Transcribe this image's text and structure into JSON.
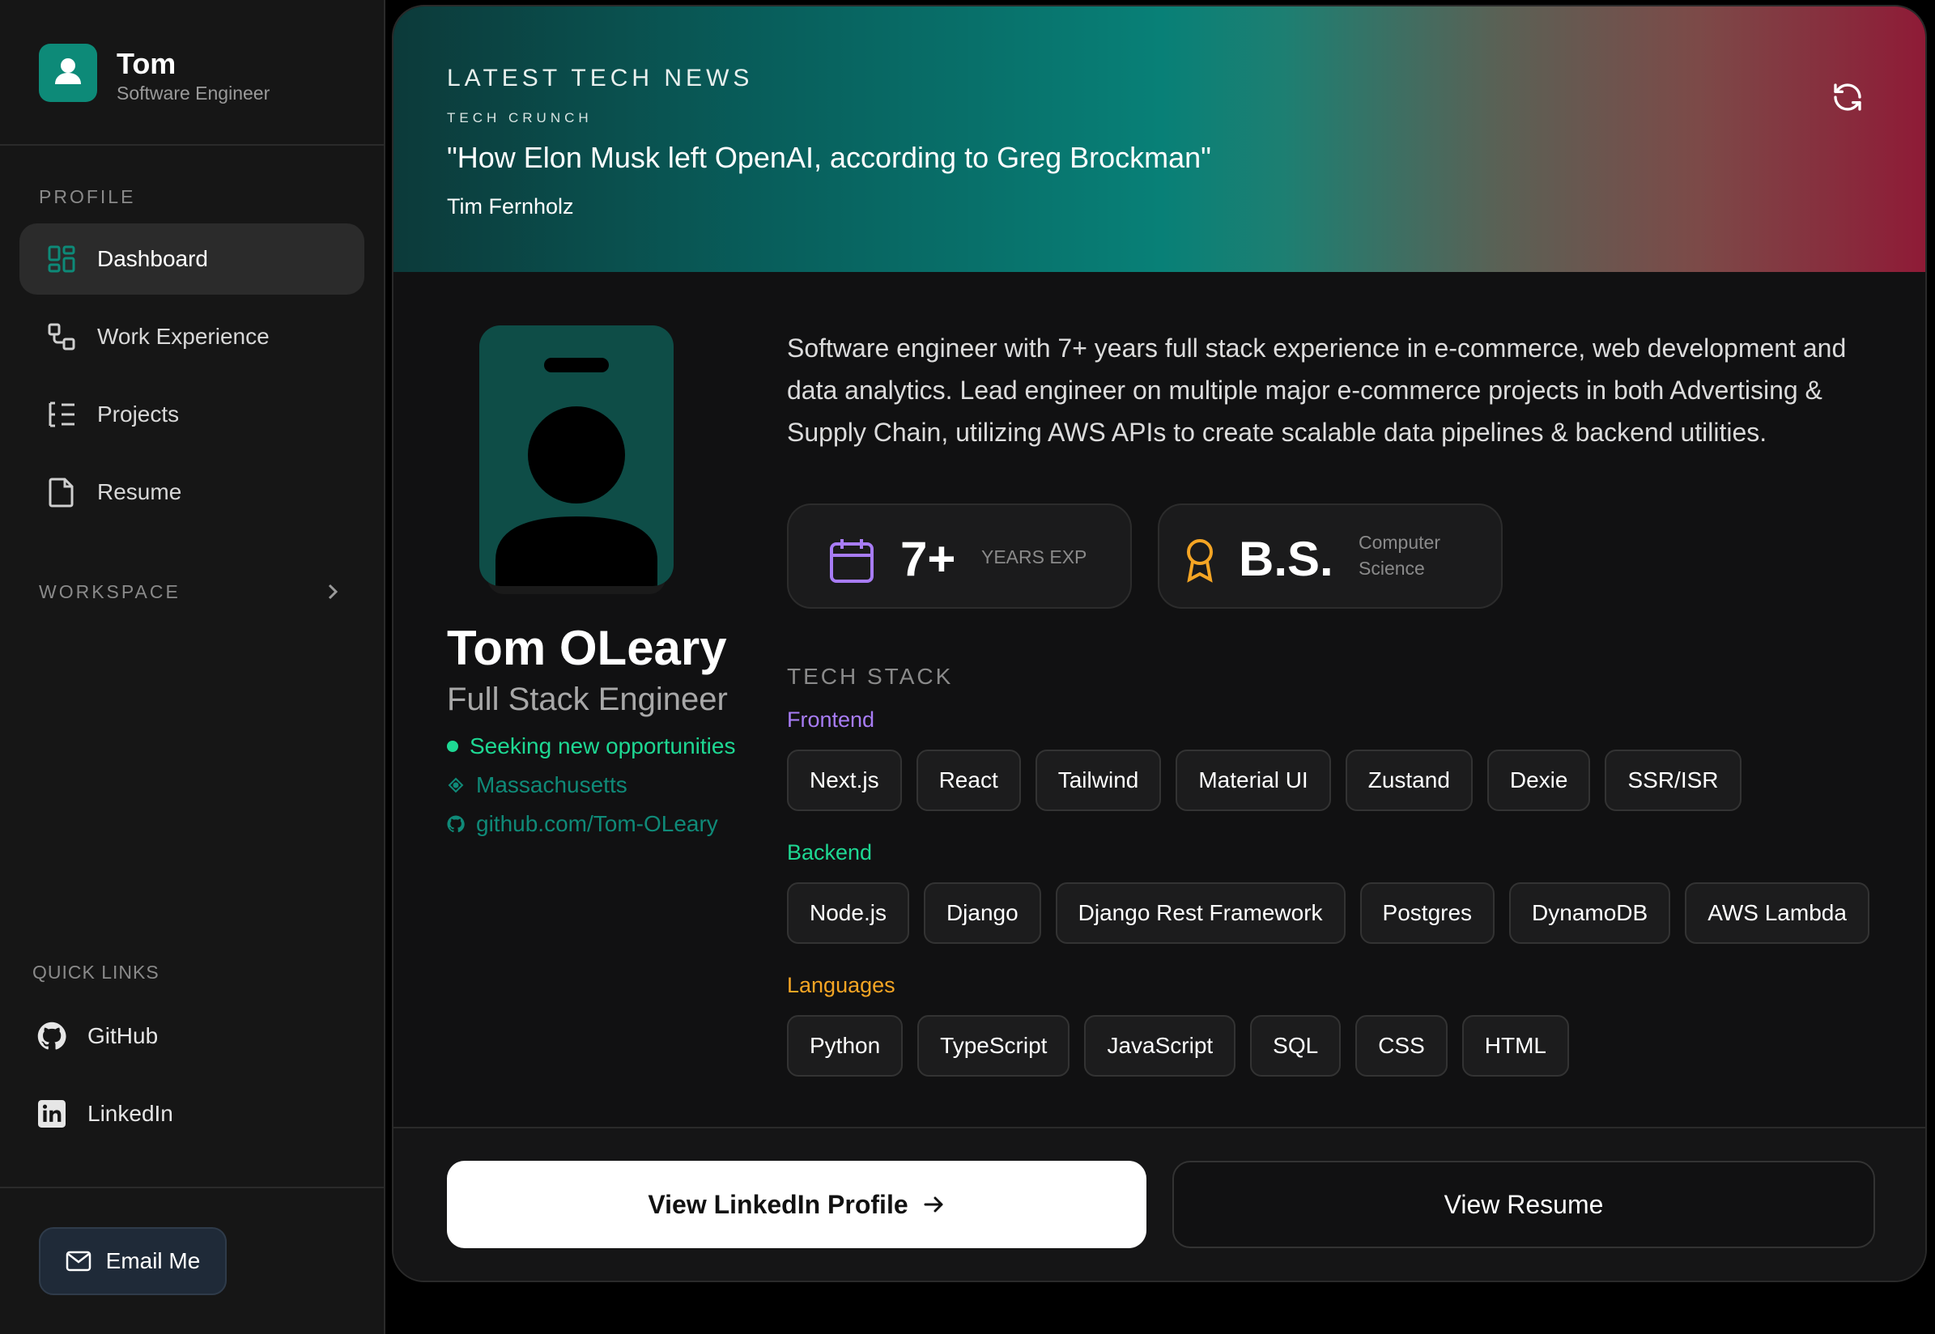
{
  "sidebar": {
    "user": {
      "name": "Tom",
      "role": "Software Engineer",
      "icon": "user-icon"
    },
    "profile_label": "PROFILE",
    "nav": [
      {
        "label": "Dashboard",
        "icon": "dashboard-grid-icon",
        "active": true
      },
      {
        "label": "Work Experience",
        "icon": "briefcase-nodes-icon",
        "active": false
      },
      {
        "label": "Projects",
        "icon": "list-tree-icon",
        "active": false
      },
      {
        "label": "Resume",
        "icon": "file-icon",
        "active": false
      }
    ],
    "workspace_label": "WORKSPACE",
    "quick_links_label": "QUICK LINKS",
    "quick_links": [
      {
        "label": "GitHub",
        "icon": "github-icon"
      },
      {
        "label": "LinkedIn",
        "icon": "linkedin-icon"
      }
    ],
    "email_button": "Email Me"
  },
  "news": {
    "label": "LATEST TECH NEWS",
    "source": "TECH CRUNCH",
    "title": "\"How Elon Musk left OpenAI, according to Greg Brockman\"",
    "author": "Tim Fernholz"
  },
  "profile": {
    "name": "Tom OLeary",
    "title": "Full Stack Engineer",
    "status": "Seeking new opportunities",
    "location": "Massachusetts",
    "github": "github.com/Tom-OLeary",
    "bio": "Software engineer with 7+ years full stack experience in e-commerce, web development and data analytics. Lead engineer on multiple major e-commerce projects in both Advertising & Supply Chain, utilizing AWS APIs to create scalable data pipelines & backend utilities."
  },
  "stats": {
    "experience": {
      "value": "7+",
      "label": "YEARS EXP"
    },
    "degree": {
      "value": "B.S.",
      "label_line1": "Computer",
      "label_line2": "Science"
    }
  },
  "tech_stack": {
    "label": "TECH STACK",
    "frontend": {
      "label": "Frontend",
      "color": "#a87cf5",
      "items": [
        "Next.js",
        "React",
        "Tailwind",
        "Material UI",
        "Zustand",
        "Dexie",
        "SSR/ISR"
      ]
    },
    "backend": {
      "label": "Backend",
      "color": "#1ed893",
      "items": [
        "Node.js",
        "Django",
        "Django Rest Framework",
        "Postgres",
        "DynamoDB",
        "AWS Lambda"
      ]
    },
    "languages": {
      "label": "Languages",
      "color": "#f5a524",
      "items": [
        "Python",
        "TypeScript",
        "JavaScript",
        "SQL",
        "CSS",
        "HTML"
      ]
    }
  },
  "actions": {
    "linkedin_button": "View LinkedIn Profile",
    "resume_button": "View Resume"
  },
  "colors": {
    "accent_teal": "#0d8a78",
    "status_green": "#1ed893",
    "frontend_purple": "#a87cf5",
    "languages_orange": "#f5a524"
  }
}
